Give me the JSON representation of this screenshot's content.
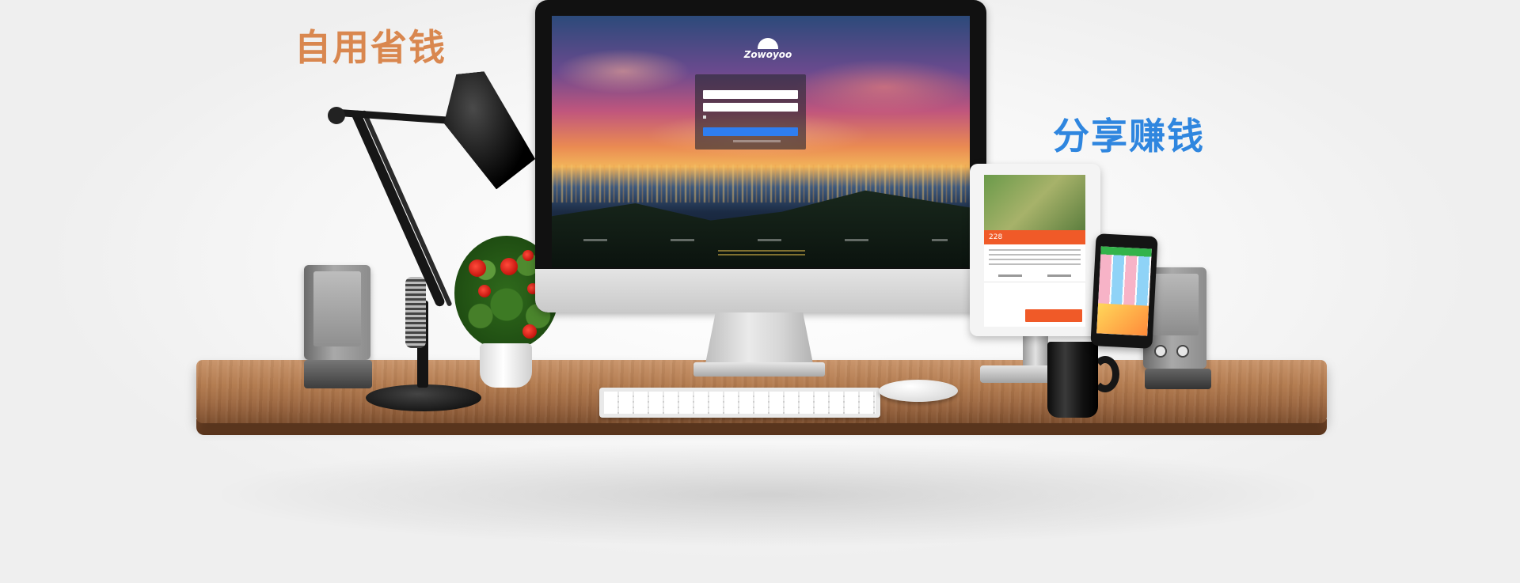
{
  "slogans": {
    "left": "自用省钱",
    "right": "分享赚钱"
  },
  "screen": {
    "logo_text": "Zowoyoo"
  },
  "tablet": {
    "price": "228"
  },
  "colors": {
    "slogan_left": "#d9874f",
    "slogan_right": "#2f86df",
    "desk": "#b27a4e",
    "accent_button": "#2f7ef0",
    "tablet_cta": "#f05a28"
  },
  "icons": {
    "logo": "zowoyoo-logo-icon"
  }
}
